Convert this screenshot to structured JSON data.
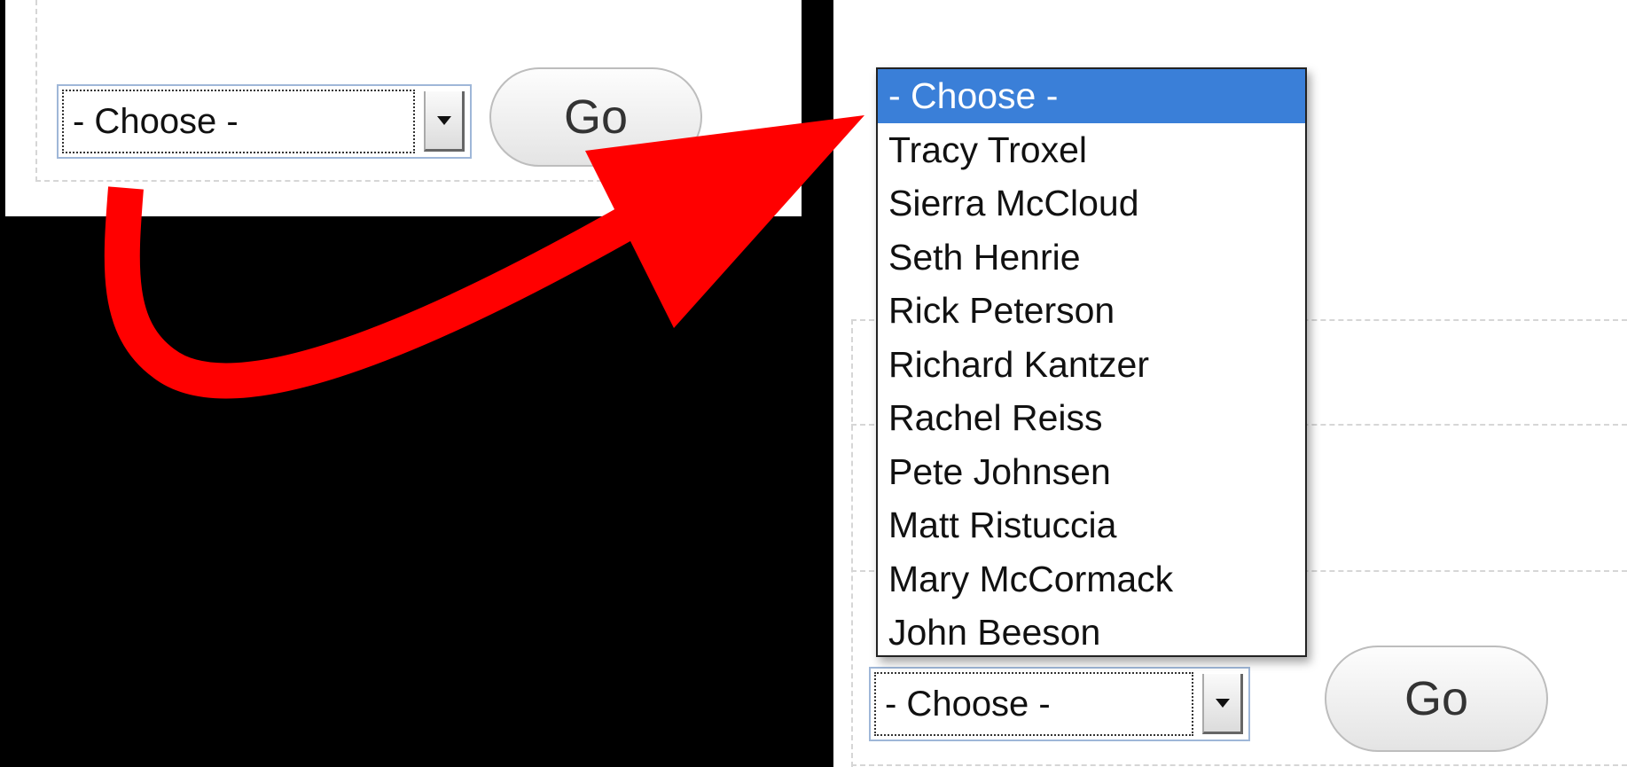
{
  "left_panel": {
    "select_value": "- Choose -",
    "go_label": "Go"
  },
  "right_panel": {
    "select_value": "- Choose -",
    "go_label": "Go",
    "dropdown_options": [
      {
        "label": "- Choose -",
        "selected": true
      },
      {
        "label": "Tracy Troxel",
        "selected": false
      },
      {
        "label": "Sierra McCloud",
        "selected": false
      },
      {
        "label": "Seth Henrie",
        "selected": false
      },
      {
        "label": "Rick Peterson",
        "selected": false
      },
      {
        "label": "Richard Kantzer",
        "selected": false
      },
      {
        "label": "Rachel Reiss",
        "selected": false
      },
      {
        "label": "Pete Johnsen",
        "selected": false
      },
      {
        "label": "Matt Ristuccia",
        "selected": false
      },
      {
        "label": "Mary McCormack",
        "selected": false
      },
      {
        "label": "John Beeson",
        "selected": false
      }
    ]
  },
  "colors": {
    "highlight": "#3a7fd8",
    "arrow": "#ff0000",
    "background": "#000000"
  },
  "icons": {
    "annotation_arrow": "curved-red-arrow",
    "select_button": "chevron-down-icon"
  }
}
